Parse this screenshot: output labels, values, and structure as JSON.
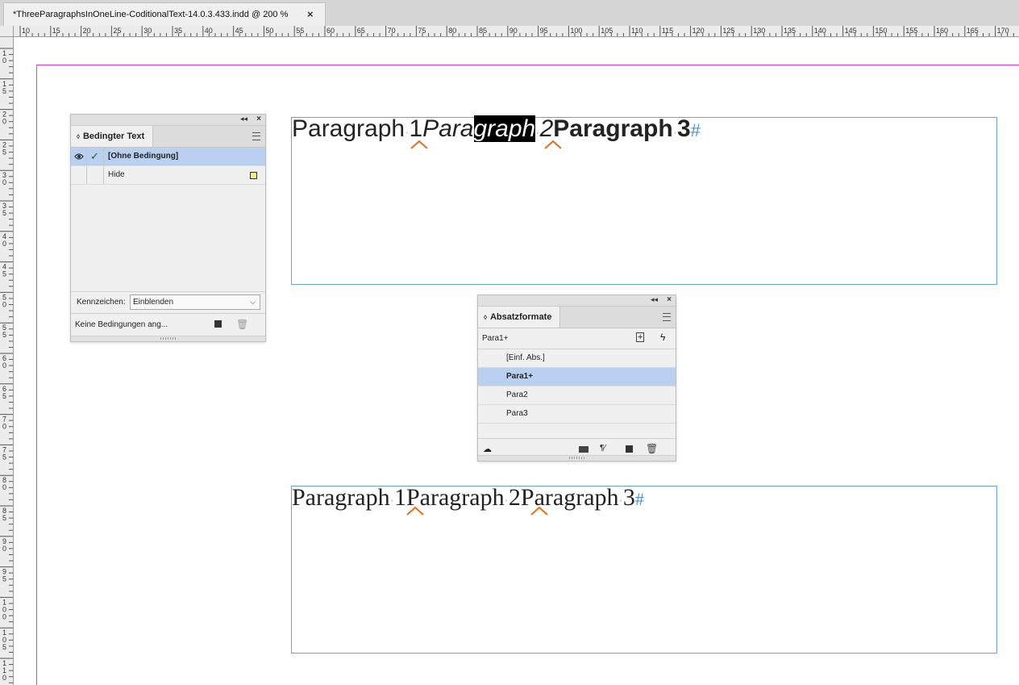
{
  "document": {
    "tab_title": "*ThreeParagraphsInOneLine-CoditionalText-14.0.3.433.indd @ 200 %",
    "close_glyph": "×"
  },
  "ruler": {
    "horizontal": [
      "10",
      "15",
      "20",
      "25",
      "30",
      "35",
      "40",
      "45",
      "50",
      "55",
      "60",
      "65",
      "70",
      "75",
      "80",
      "85",
      "90",
      "95",
      "100",
      "105",
      "110",
      "115",
      "120",
      "125",
      "130",
      "135",
      "140",
      "145",
      "150",
      "155",
      "160",
      "165",
      "170"
    ],
    "vertical": [
      "10",
      "15",
      "20",
      "25",
      "30",
      "35",
      "40",
      "45",
      "50",
      "55",
      "60",
      "65",
      "70",
      "75",
      "80",
      "85",
      "90",
      "95",
      "100",
      "105",
      "110"
    ]
  },
  "frame_top": {
    "p1": "Paragraph",
    "p1_num": "1",
    "p2_pre": "Para",
    "p2_sel": "graph",
    "p2_num": "2",
    "p3": "Paragraph",
    "p3_num": "3",
    "end_mark": "#"
  },
  "frame_bottom": {
    "p1": "Paragraph",
    "p1_num": "1",
    "p2": "Paragraph",
    "p2_num": "2",
    "p3": "Paragraph",
    "p3_num": "3",
    "end_mark": "#"
  },
  "conditional_panel": {
    "tab_label": "Bedingter Text",
    "rows": [
      {
        "label": "[Ohne Bedingung]",
        "selected": true
      },
      {
        "label": "Hide",
        "selected": false
      }
    ],
    "indicator_label": "Kennzeichen:",
    "indicator_value": "Einblenden",
    "status_text": "Keine Bedingungen ang...",
    "colors": {
      "hide_swatch": "#f3ee8a",
      "selected_row": "#b9d0f0"
    }
  },
  "paragraph_panel": {
    "tab_label": "Absatzformate",
    "current_style": "Para1+",
    "styles": [
      {
        "label": "[Einf. Abs.]",
        "selected": false
      },
      {
        "label": "Para1+",
        "selected": true
      },
      {
        "label": "Para2",
        "selected": false
      },
      {
        "label": "Para3",
        "selected": false
      }
    ]
  },
  "colors": {
    "page_edge": "#d34ad1",
    "frame_border": "#6aa1d8",
    "caret": "#e0701a",
    "end_mark": "#4a8fd8"
  }
}
